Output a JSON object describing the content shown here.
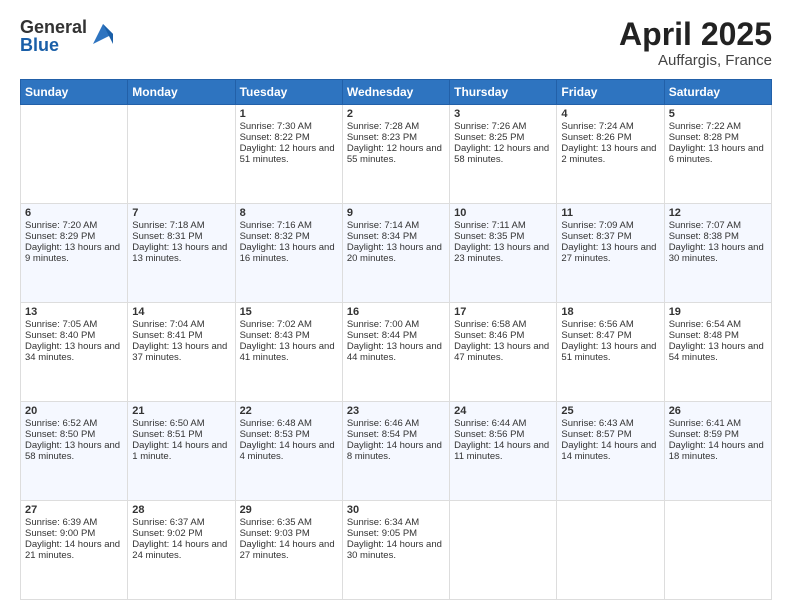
{
  "logo": {
    "general": "General",
    "blue": "Blue"
  },
  "header": {
    "month": "April 2025",
    "location": "Auffargis, France"
  },
  "days": [
    "Sunday",
    "Monday",
    "Tuesday",
    "Wednesday",
    "Thursday",
    "Friday",
    "Saturday"
  ],
  "weeks": [
    [
      {
        "day": "",
        "info": ""
      },
      {
        "day": "",
        "info": ""
      },
      {
        "day": "1",
        "info": "Sunrise: 7:30 AM\nSunset: 8:22 PM\nDaylight: 12 hours and 51 minutes."
      },
      {
        "day": "2",
        "info": "Sunrise: 7:28 AM\nSunset: 8:23 PM\nDaylight: 12 hours and 55 minutes."
      },
      {
        "day": "3",
        "info": "Sunrise: 7:26 AM\nSunset: 8:25 PM\nDaylight: 12 hours and 58 minutes."
      },
      {
        "day": "4",
        "info": "Sunrise: 7:24 AM\nSunset: 8:26 PM\nDaylight: 13 hours and 2 minutes."
      },
      {
        "day": "5",
        "info": "Sunrise: 7:22 AM\nSunset: 8:28 PM\nDaylight: 13 hours and 6 minutes."
      }
    ],
    [
      {
        "day": "6",
        "info": "Sunrise: 7:20 AM\nSunset: 8:29 PM\nDaylight: 13 hours and 9 minutes."
      },
      {
        "day": "7",
        "info": "Sunrise: 7:18 AM\nSunset: 8:31 PM\nDaylight: 13 hours and 13 minutes."
      },
      {
        "day": "8",
        "info": "Sunrise: 7:16 AM\nSunset: 8:32 PM\nDaylight: 13 hours and 16 minutes."
      },
      {
        "day": "9",
        "info": "Sunrise: 7:14 AM\nSunset: 8:34 PM\nDaylight: 13 hours and 20 minutes."
      },
      {
        "day": "10",
        "info": "Sunrise: 7:11 AM\nSunset: 8:35 PM\nDaylight: 13 hours and 23 minutes."
      },
      {
        "day": "11",
        "info": "Sunrise: 7:09 AM\nSunset: 8:37 PM\nDaylight: 13 hours and 27 minutes."
      },
      {
        "day": "12",
        "info": "Sunrise: 7:07 AM\nSunset: 8:38 PM\nDaylight: 13 hours and 30 minutes."
      }
    ],
    [
      {
        "day": "13",
        "info": "Sunrise: 7:05 AM\nSunset: 8:40 PM\nDaylight: 13 hours and 34 minutes."
      },
      {
        "day": "14",
        "info": "Sunrise: 7:04 AM\nSunset: 8:41 PM\nDaylight: 13 hours and 37 minutes."
      },
      {
        "day": "15",
        "info": "Sunrise: 7:02 AM\nSunset: 8:43 PM\nDaylight: 13 hours and 41 minutes."
      },
      {
        "day": "16",
        "info": "Sunrise: 7:00 AM\nSunset: 8:44 PM\nDaylight: 13 hours and 44 minutes."
      },
      {
        "day": "17",
        "info": "Sunrise: 6:58 AM\nSunset: 8:46 PM\nDaylight: 13 hours and 47 minutes."
      },
      {
        "day": "18",
        "info": "Sunrise: 6:56 AM\nSunset: 8:47 PM\nDaylight: 13 hours and 51 minutes."
      },
      {
        "day": "19",
        "info": "Sunrise: 6:54 AM\nSunset: 8:48 PM\nDaylight: 13 hours and 54 minutes."
      }
    ],
    [
      {
        "day": "20",
        "info": "Sunrise: 6:52 AM\nSunset: 8:50 PM\nDaylight: 13 hours and 58 minutes."
      },
      {
        "day": "21",
        "info": "Sunrise: 6:50 AM\nSunset: 8:51 PM\nDaylight: 14 hours and 1 minute."
      },
      {
        "day": "22",
        "info": "Sunrise: 6:48 AM\nSunset: 8:53 PM\nDaylight: 14 hours and 4 minutes."
      },
      {
        "day": "23",
        "info": "Sunrise: 6:46 AM\nSunset: 8:54 PM\nDaylight: 14 hours and 8 minutes."
      },
      {
        "day": "24",
        "info": "Sunrise: 6:44 AM\nSunset: 8:56 PM\nDaylight: 14 hours and 11 minutes."
      },
      {
        "day": "25",
        "info": "Sunrise: 6:43 AM\nSunset: 8:57 PM\nDaylight: 14 hours and 14 minutes."
      },
      {
        "day": "26",
        "info": "Sunrise: 6:41 AM\nSunset: 8:59 PM\nDaylight: 14 hours and 18 minutes."
      }
    ],
    [
      {
        "day": "27",
        "info": "Sunrise: 6:39 AM\nSunset: 9:00 PM\nDaylight: 14 hours and 21 minutes."
      },
      {
        "day": "28",
        "info": "Sunrise: 6:37 AM\nSunset: 9:02 PM\nDaylight: 14 hours and 24 minutes."
      },
      {
        "day": "29",
        "info": "Sunrise: 6:35 AM\nSunset: 9:03 PM\nDaylight: 14 hours and 27 minutes."
      },
      {
        "day": "30",
        "info": "Sunrise: 6:34 AM\nSunset: 9:05 PM\nDaylight: 14 hours and 30 minutes."
      },
      {
        "day": "",
        "info": ""
      },
      {
        "day": "",
        "info": ""
      },
      {
        "day": "",
        "info": ""
      }
    ]
  ]
}
